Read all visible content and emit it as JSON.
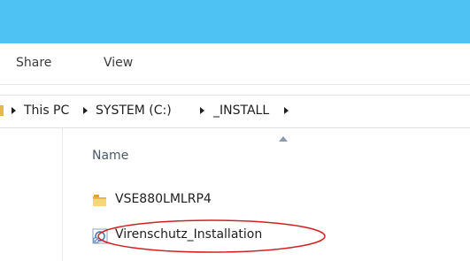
{
  "ribbon": {
    "tabs": [
      {
        "label": "Share"
      },
      {
        "label": "View"
      }
    ]
  },
  "address": {
    "crumbs": [
      {
        "label": "This PC"
      },
      {
        "label": "SYSTEM (C:)"
      },
      {
        "label": "_INSTALL"
      }
    ]
  },
  "list": {
    "column_name": "Name",
    "items": [
      {
        "label": "VSE880LMLRP4",
        "icon": "folder-icon"
      },
      {
        "label": "Virenschutz_Installation",
        "icon": "shortcut-icon"
      }
    ]
  },
  "colors": {
    "titlebar": "#4fc2f4",
    "highlight": "#d42020",
    "folder": "#e8b74a"
  }
}
